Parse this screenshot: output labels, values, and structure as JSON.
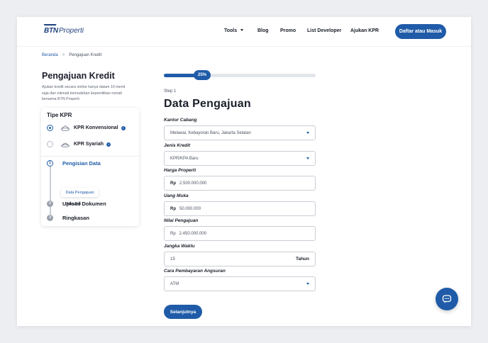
{
  "brand": {
    "logo_main": "BTN",
    "logo_sub": "Properti"
  },
  "nav": {
    "items": [
      "Tools",
      "Blog",
      "Promo",
      "List Developer",
      "Ajukan KPR"
    ],
    "login_label": "Daftar atau Masuk"
  },
  "breadcrumb": {
    "home": "Beranda",
    "separator": ">",
    "current": "Pengajuan Kredit"
  },
  "sidebar": {
    "title": "Pengajuan Kredit",
    "description": "Ajukan kredit secara online hanya dalam 10 menit saja dan nikmati kemudahan kepemilikan rumah bersama BTN Properti.",
    "kpr_heading": "Tipe KPR",
    "kpr_options": [
      {
        "label": "KPR Konvensional",
        "selected": true,
        "icon": "house-coins-icon"
      },
      {
        "label": "KPR Syariah",
        "selected": false,
        "icon": "mosque-icon"
      }
    ],
    "steps": [
      {
        "number": "1",
        "label": "Pengisian Data",
        "active": true
      },
      {
        "number": "2",
        "label": "Upload Dokumen",
        "active": false
      },
      {
        "number": "3",
        "label": "Ringkasan",
        "active": false
      }
    ],
    "substeps": [
      "Data Pengajuan",
      "Data Diri"
    ]
  },
  "progress": {
    "percent": 25,
    "label": "25%"
  },
  "form": {
    "step_caption": "Step 1",
    "title": "Data Pengajuan",
    "fields": [
      {
        "label": "Kantor Cabang",
        "value": "Melawai, Kebayoran Baru, Jakarta Selatan",
        "type": "select"
      },
      {
        "label": "Jenis Kredit",
        "value": "KPR/KPA Baru",
        "type": "select"
      },
      {
        "label": "Harga Properti",
        "prefix": "Rp",
        "value": "2.500.000.000",
        "type": "currency"
      },
      {
        "label": "Uang Muka",
        "prefix": "Rp",
        "value": "50.000.000",
        "type": "currency"
      },
      {
        "label": "Nilai Pengajuan",
        "prefix": "Rp",
        "value": "2.450.000.000",
        "type": "currency"
      },
      {
        "label": "Jangka Waktu",
        "value": "15",
        "suffix": "Tahun",
        "type": "number"
      },
      {
        "label": "Cara Pembayaran Angsuran",
        "value": "ATM",
        "type": "select"
      }
    ],
    "submit_label": "Selanjutnya"
  },
  "colors": {
    "primary": "#1f5ba8",
    "text": "#1b1f2a",
    "muted": "#5e6573",
    "border": "#c9ced6"
  }
}
